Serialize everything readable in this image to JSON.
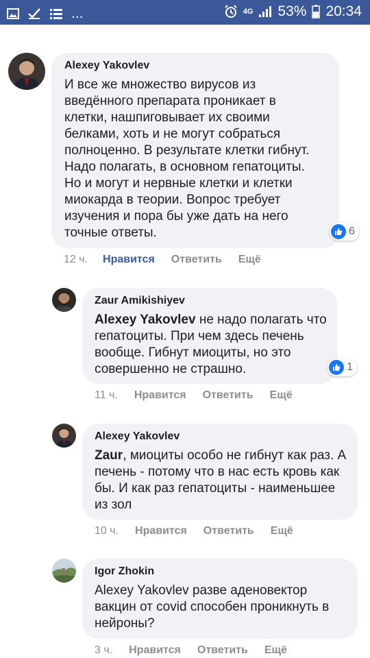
{
  "status_bar": {
    "battery_percent": "53%",
    "time": "20:34",
    "network": "4G",
    "overflow": "...",
    "icons": [
      "image-icon",
      "check-icon",
      "list-icon",
      "alarm-icon",
      "signal-icon",
      "battery-icon"
    ]
  },
  "comments": [
    {
      "author": "Alexey Yakovlev",
      "text": "И все же множество вирусов из введённого препарата проникает в клетки, нашпиговывает их своими белками, хоть и не могут собраться полноценно. В результате клетки гибнут. Надо полагать, в основном гепатоциты. Но и могут и нервные клетки и клетки миокарда в теории. Вопрос требует изучения и пора бы уже дать на него точные ответы.",
      "time": "12 ч.",
      "like": "Нравится",
      "reply": "Ответить",
      "more": "Ещё",
      "reactions": "6"
    },
    {
      "author": "Zaur Amikishiyev",
      "mention": "Alexey Yakovlev",
      "text": " не надо полагать что гепатоциты. При чем здесь печень вообще. Гибнут миоциты, но это совершенно не страшно.",
      "time": "11 ч.",
      "like": "Нравится",
      "reply": "Ответить",
      "more": "Ещё",
      "reactions": "1"
    },
    {
      "author": "Alexey Yakovlev",
      "mention": "Zaur",
      "text": ", миоциты особо не гибнут как раз. А печень - потому что в нас есть кровь как бы. И как раз гепатоциты - наименьшее из зол",
      "time": "10 ч.",
      "like": "Нравится",
      "reply": "Ответить",
      "more": "Ещё"
    },
    {
      "author": "Igor Zhokin",
      "text": "Alexey Yakovlev разве аденовектор вакцин от covid способен проникнуть в нейроны?",
      "time": "3 ч.",
      "like": "Нравится",
      "reply": "Ответить",
      "more": "Ещё"
    }
  ],
  "colors": {
    "status_bar": "#3b5998",
    "bubble": "#f0f2f5",
    "like_active": "#3b5998",
    "meta_gray": "#8a8d91",
    "reaction_blue": "#1877f2"
  }
}
